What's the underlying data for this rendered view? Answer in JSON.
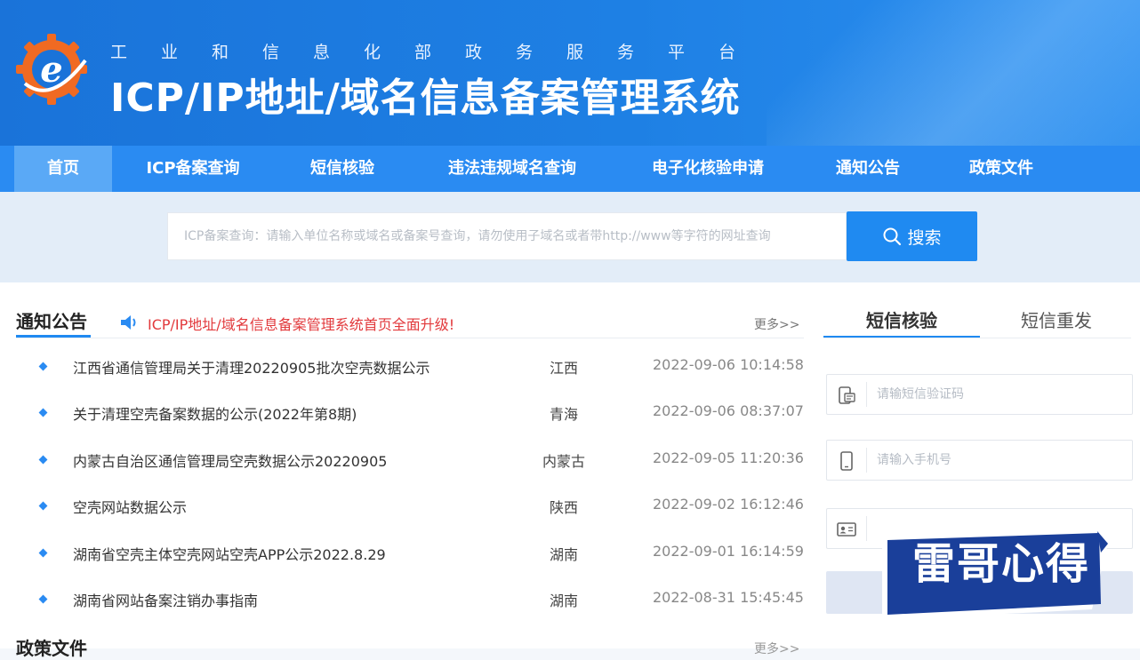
{
  "header": {
    "subtitle": "工业和信息化部政务服务平台",
    "title": "ICP/IP地址/域名信息备案管理系统"
  },
  "nav": {
    "items": [
      {
        "label": "首页",
        "active": true
      },
      {
        "label": "ICP备案查询"
      },
      {
        "label": "短信核验"
      },
      {
        "label": "违法违规域名查询"
      },
      {
        "label": "电子化核验申请"
      },
      {
        "label": "通知公告"
      },
      {
        "label": "政策文件"
      }
    ]
  },
  "search": {
    "placeholder": "ICP备案查询：请输入单位名称或域名或备案号查询，请勿使用子域名或者带http://www等字符的网址查询",
    "button_label": "搜索"
  },
  "notices": {
    "title": "通知公告",
    "highlight": "ICP/IP地址/域名信息备案管理系统首页全面升级!",
    "more": "更多>>",
    "rows": [
      {
        "title": "江西省通信管理局关于清理20220905批次空壳数据公示",
        "region": "江西",
        "date": "2022-09-06 10:14:58"
      },
      {
        "title": "关于清理空壳备案数据的公示(2022年第8期)",
        "region": "青海",
        "date": "2022-09-06 08:37:07"
      },
      {
        "title": "内蒙古自治区通信管理局空壳数据公示20220905",
        "region": "内蒙古",
        "date": "2022-09-05 11:20:36"
      },
      {
        "title": "空壳网站数据公示",
        "region": "陕西",
        "date": "2022-09-02 16:12:46"
      },
      {
        "title": "湖南省空壳主体空壳网站空壳APP公示2022.8.29",
        "region": "湖南",
        "date": "2022-09-01 16:14:59"
      },
      {
        "title": "湖南省网站备案注销办事指南",
        "region": "湖南",
        "date": "2022-08-31 15:45:45"
      }
    ]
  },
  "policy": {
    "title": "政策文件",
    "more": "更多>>"
  },
  "sms_panel": {
    "tab_active": "短信核验",
    "tab_other": "短信重发",
    "code_placeholder": "请输短信验证码",
    "phone_placeholder": "请输入手机号",
    "id_placeholder": ""
  },
  "watermark": {
    "text": "雷哥心得"
  },
  "colors": {
    "brand_blue": "#1f8af1",
    "nav_blue": "#2a8bf2",
    "notice_red": "#e2393c"
  }
}
